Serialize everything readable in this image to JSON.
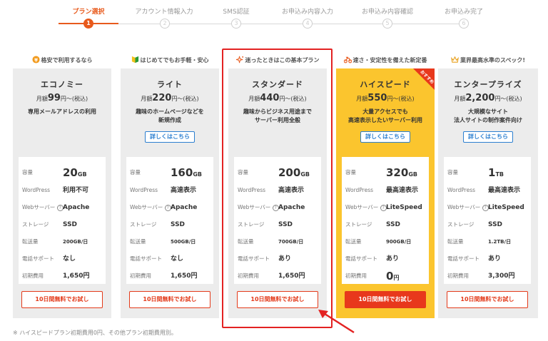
{
  "stepper": {
    "steps": [
      {
        "label": "プラン選択",
        "num": "1"
      },
      {
        "label": "アカウント情報入力",
        "num": "2"
      },
      {
        "label": "SMS認証",
        "num": "3"
      },
      {
        "label": "お申込み内容入力",
        "num": "4"
      },
      {
        "label": "お申込み内容確認",
        "num": "5"
      },
      {
        "label": "お申込み完了",
        "num": "6"
      }
    ]
  },
  "spec_labels": {
    "storage_cap": "容量",
    "wordpress": "WordPress",
    "webserver": "Webサーバー",
    "storage": "ストレージ",
    "transfer": "転送量",
    "phone": "電話サポート",
    "setup": "初期費用"
  },
  "price_prefix": "月額",
  "price_suffix": "円～(税込)",
  "detail_label": "詳しくはこちら",
  "trial_label": "10日間無料でお試し",
  "plans": [
    {
      "headline": "格安で利用するなら",
      "name": "エコノミー",
      "price": "99",
      "desc1": "専用メールアドレスの利用",
      "desc2": "",
      "capacity": "20",
      "capacity_unit": "GB",
      "wordpress": "利用不可",
      "webserver": "Apache",
      "storage": "SSD",
      "transfer": "200GB/日",
      "phone": "なし",
      "setup": "1,650円"
    },
    {
      "headline": "はじめてでもお手軽・安心",
      "name": "ライト",
      "price": "220",
      "desc1": "趣味のホームページなどを",
      "desc2": "新規作成",
      "capacity": "160",
      "capacity_unit": "GB",
      "wordpress": "高速表示",
      "webserver": "Apache",
      "storage": "SSD",
      "transfer": "500GB/日",
      "phone": "なし",
      "setup": "1,650円"
    },
    {
      "headline": "迷ったときはこの基本プラン",
      "name": "スタンダード",
      "price": "440",
      "desc1": "趣味からビジネス用途まで",
      "desc2": "サーバー利用全般",
      "capacity": "200",
      "capacity_unit": "GB",
      "wordpress": "高速表示",
      "webserver": "Apache",
      "storage": "SSD",
      "transfer": "700GB/日",
      "phone": "あり",
      "setup": "1,650円"
    },
    {
      "headline": "速さ・安定性を備えた新定番",
      "name": "ハイスピード",
      "price": "550",
      "desc1": "大量アクセスでも",
      "desc2": "高速表示したいサーバー利用",
      "capacity": "320",
      "capacity_unit": "GB",
      "wordpress": "最高速表示",
      "webserver": "LiteSpeed",
      "storage": "SSD",
      "transfer": "900GB/日",
      "phone": "あり",
      "setup_num": "0",
      "setup_unit": "円",
      "badge": "おすすめ"
    },
    {
      "headline": "業界最高水準のスペック!",
      "name": "エンタープライズ",
      "price": "2,200",
      "desc1": "大規模なサイト",
      "desc2": "法人サイトの制作案件向け",
      "capacity": "1",
      "capacity_unit": "TB",
      "wordpress": "最高速表示",
      "webserver": "LiteSpeed",
      "storage": "SSD",
      "transfer": "1.2TB/日",
      "phone": "あり",
      "setup": "3,300円"
    }
  ],
  "footnote": "※ ハイスピードプラン初期費用0円、その他プラン初期費用別。",
  "colors": {
    "accent_orange": "#e85a1c",
    "trial_red": "#e33a1a",
    "featured_yellow": "#fbc52e",
    "highlight_red": "#e32222",
    "link_blue": "#2c7fd0"
  }
}
